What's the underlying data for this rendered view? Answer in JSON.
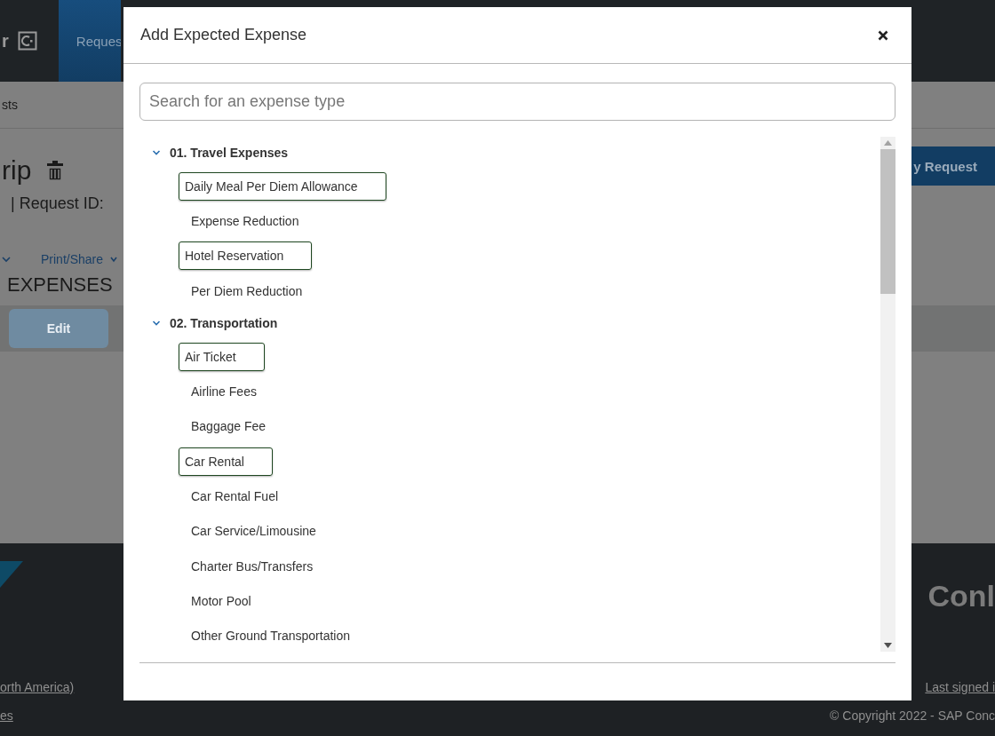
{
  "background": {
    "logo_letter": "r",
    "nav_tab": "Reques",
    "breadcrumb": "sts",
    "title": "rip",
    "request_id": "| Request ID:",
    "print_menu": "Print/Share",
    "section_heading": "EXPENSES",
    "edit_button": "Edit",
    "submit_button": "y Request",
    "footer_brand": "Conl",
    "footer_link_left": "orth America)",
    "footer_link_left_2": "es",
    "footer_link_right": "Last signed i",
    "copyright": "© Copyright 2022 - SAP Conc"
  },
  "dialog": {
    "title": "Add Expected Expense",
    "search": {
      "placeholder": "Search for an expense type"
    },
    "groups": [
      {
        "label": "01. Travel Expenses",
        "expanded": true,
        "children": [
          {
            "label": "Daily Meal Per Diem Allowance",
            "highlighted": true
          },
          {
            "label": "Expense Reduction",
            "highlighted": false
          },
          {
            "label": "Hotel Reservation",
            "highlighted": true
          },
          {
            "label": "Per Diem Reduction",
            "highlighted": false
          }
        ]
      },
      {
        "label": "02. Transportation",
        "expanded": true,
        "children": [
          {
            "label": "Air Ticket",
            "highlighted": true
          },
          {
            "label": "Airline Fees",
            "highlighted": false
          },
          {
            "label": "Baggage Fee",
            "highlighted": false
          },
          {
            "label": "Car Rental",
            "highlighted": true
          },
          {
            "label": "Car Rental Fuel",
            "highlighted": false
          },
          {
            "label": "Car Service/Limousine",
            "highlighted": false
          },
          {
            "label": "Charter Bus/Transfers",
            "highlighted": false
          },
          {
            "label": "Motor Pool",
            "highlighted": false
          },
          {
            "label": "Other Ground Transportation",
            "highlighted": false
          }
        ]
      }
    ]
  }
}
